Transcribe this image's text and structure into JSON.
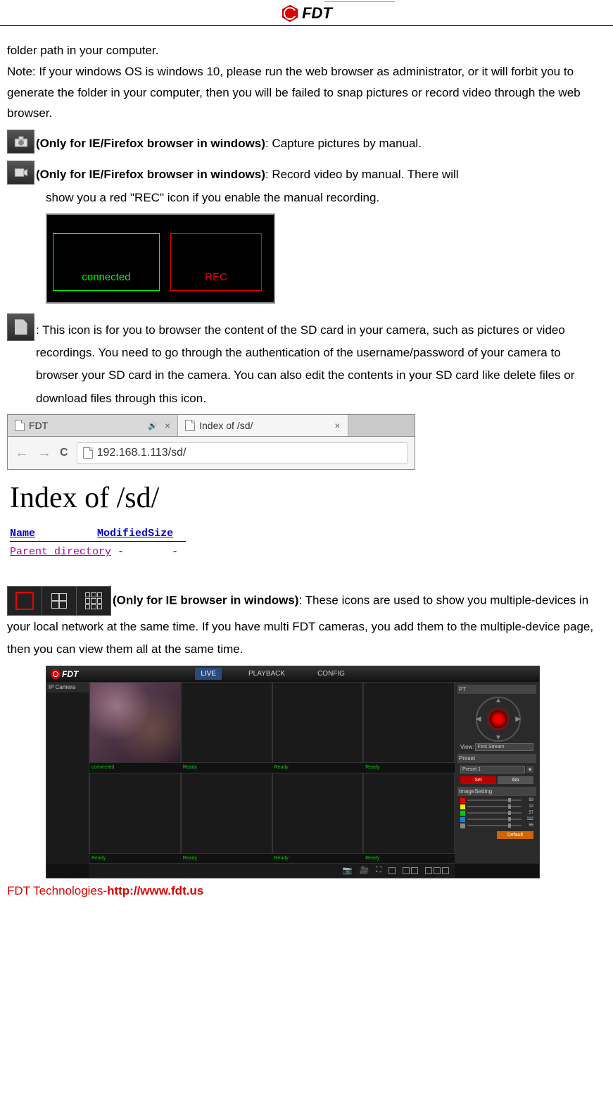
{
  "header": {
    "brand": "FDT"
  },
  "intro": {
    "line1": "folder path in your computer.",
    "note": "Note: If your windows OS is windows 10, please run the web browser as administrator, or it will forbit you to generate the folder in your computer, then you will be failed to snap pictures or record video through the web browser."
  },
  "capture": {
    "label": "(Only for IE/Firefox browser in windows)",
    "desc": ": Capture pictures by manual."
  },
  "record": {
    "label": "(Only for IE/Firefox browser in windows)",
    "desc": ": Record video by manual. There will",
    "desc2": "show you a red \"REC\" icon if you enable the manual recording."
  },
  "rec_img": {
    "connected": "connected",
    "rec": "REC"
  },
  "sd": {
    "desc": ": This icon is for you to browser the content of the SD card in your camera, such as pictures or video recordings. You need to go through the authentication of the username/password of your camera to browser your SD card in the camera. You can also edit the contents in your SD card like delete files or download files through this icon."
  },
  "browser": {
    "tab1": "FDT",
    "tab2": "Index of /sd/",
    "url": "192.168.1.113/sd/",
    "h1": "Index of /sd/",
    "col_name": "Name",
    "col_mod": "Modified",
    "col_size": "Size",
    "row_parent": "Parent directory",
    "dash": "-"
  },
  "grid": {
    "label": "(Only for IE browser in windows)",
    "desc": ": These icons are used to show you multiple-devices in your local network at the same time. If you have multi FDT cameras, you add them to the multiple-device page, then you can view them all at the same time."
  },
  "app": {
    "brand": "FDT",
    "tabs": {
      "live": "LIVE",
      "playback": "PLAYBACK",
      "config": "CONFIG"
    },
    "left_head": "IP Camera",
    "status_connected": "connected",
    "status_ready": "Ready",
    "right": {
      "pt": "PT",
      "view": "View:",
      "stream": "First Stream",
      "preset_label": "Preset",
      "preset_val": "Preset 1",
      "set": "Set",
      "go": "Go",
      "img": "ImageSetting",
      "s1": "93",
      "s2": "12",
      "s3": "57",
      "s4": "112",
      "s5": "55",
      "default": "Default"
    }
  },
  "footer": {
    "company": "FDT Technologies-",
    "url": "http://www.fdt.us"
  }
}
